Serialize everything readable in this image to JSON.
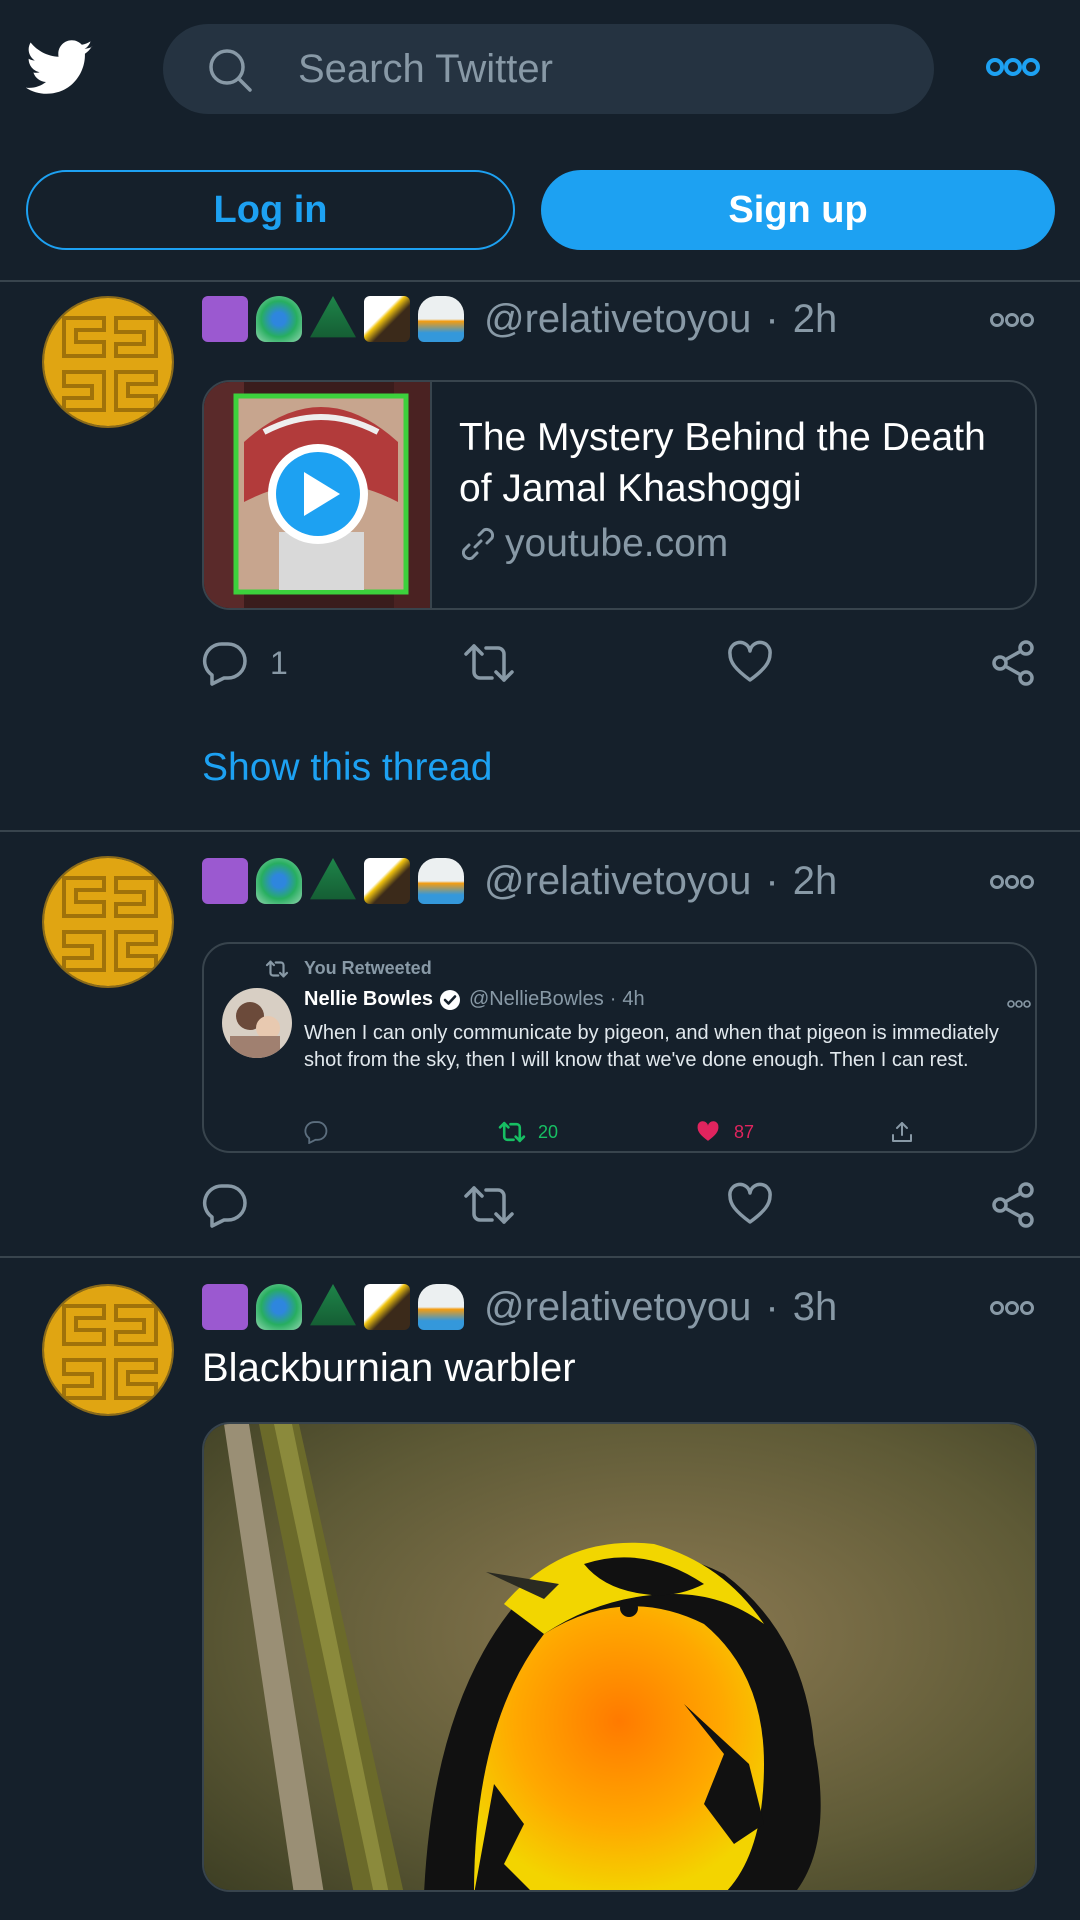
{
  "header": {
    "search_placeholder": "Search Twitter",
    "login_label": "Log in",
    "signup_label": "Sign up",
    "brand_color": "#1da1f2"
  },
  "tweets": [
    {
      "emojis": [
        "medical-symbol",
        "peacock",
        "evergreen-tree",
        "eagle",
        "cloud-with-lightning-and-rain"
      ],
      "handle": "@relativetoyou",
      "time": "2h",
      "card": {
        "title": "The Mystery Behind the Death of Jamal Khashoggi",
        "domain": "youtube.com"
      },
      "reply_count": "1",
      "show_thread": "Show this thread"
    },
    {
      "emojis": [
        "medical-symbol",
        "peacock",
        "evergreen-tree",
        "eagle",
        "cloud-with-lightning-and-rain"
      ],
      "handle": "@relativetoyou",
      "time": "2h",
      "retweet_screenshot": {
        "label": "You Retweeted",
        "name": "Nellie Bowles",
        "handle": "@NellieBowles",
        "time": "4h",
        "text": "When I can only communicate by pigeon, and when that pigeon is immediately shot from the sky, then I will know that we've done enough. Then I can rest.",
        "retweets": "20",
        "likes": "87"
      }
    },
    {
      "emojis": [
        "medical-symbol",
        "peacock",
        "evergreen-tree",
        "eagle",
        "cloud-with-lightning-and-rain"
      ],
      "handle": "@relativetoyou",
      "time": "3h",
      "text": "Blackburnian warbler"
    }
  ]
}
